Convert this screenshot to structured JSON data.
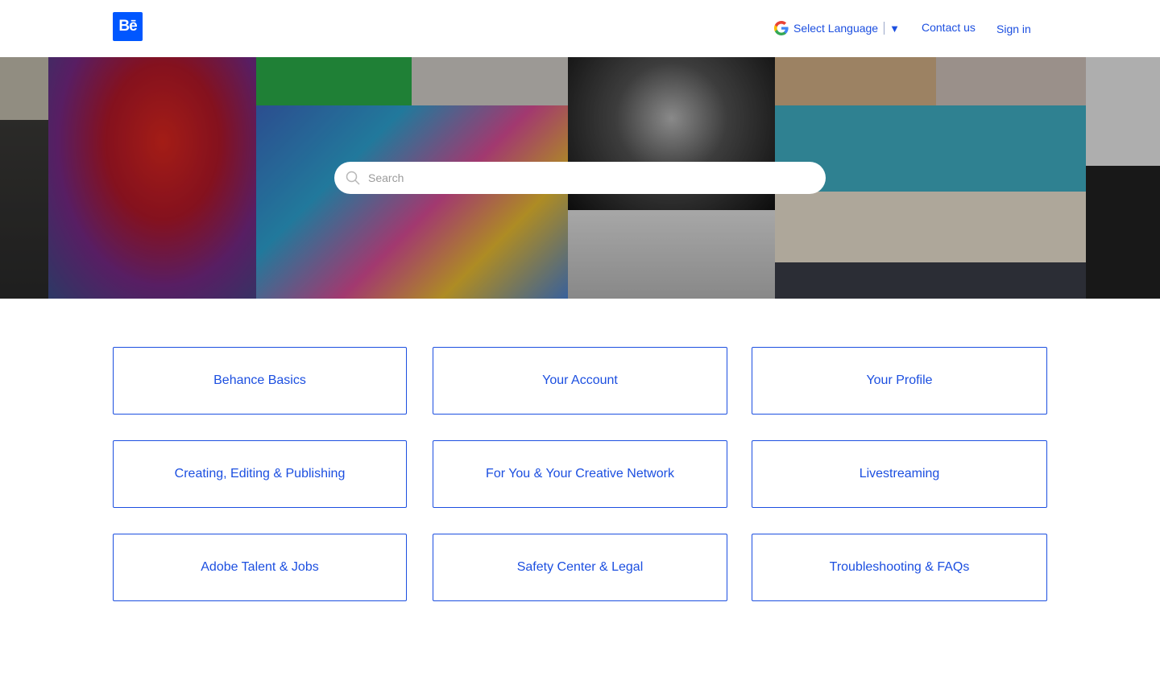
{
  "header": {
    "logo_text": "Bē",
    "select_language": "Select Language",
    "caret": "▼",
    "contact": "Contact us",
    "signin": "Sign in"
  },
  "search": {
    "placeholder": "Search"
  },
  "categories": [
    "Behance Basics",
    "Your Account",
    "Your Profile",
    "Creating, Editing & Publishing",
    "For You & Your Creative Network",
    "Livestreaming",
    "Adobe Talent & Jobs",
    "Safety Center & Legal",
    "Troubleshooting & FAQs"
  ],
  "colors": {
    "brand": "#0057ff",
    "link": "#1c4fe0"
  }
}
